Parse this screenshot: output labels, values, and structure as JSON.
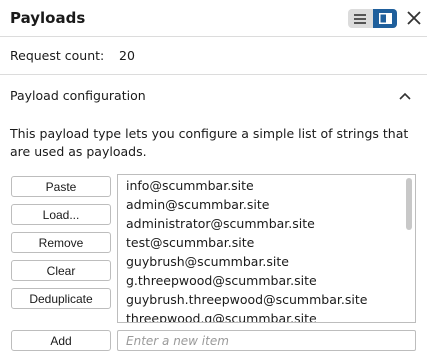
{
  "header": {
    "title": "Payloads",
    "icons": [
      "list-view-icon",
      "split-view-icon",
      "close-icon"
    ],
    "accent_color": "#1f5f9c"
  },
  "request_count": {
    "label": "Request count:",
    "value": "20"
  },
  "payload_configuration": {
    "title": "Payload configuration",
    "description": "This payload type lets you configure a simple list of strings that are used as payloads."
  },
  "buttons": {
    "paste": "Paste",
    "load": "Load...",
    "remove": "Remove",
    "clear": "Clear",
    "deduplicate": "Deduplicate",
    "add": "Add"
  },
  "payload_list": [
    "info@scummbar.site",
    "admin@scummbar.site",
    "administrator@scummbar.site",
    "test@scummbar.site",
    "guybrush@scummbar.site",
    "g.threepwood@scummbar.site",
    "guybrush.threepwood@scummbar.site",
    "threepwood.g@scummbar.site"
  ],
  "new_item": {
    "placeholder": "Enter a new item",
    "value": ""
  }
}
